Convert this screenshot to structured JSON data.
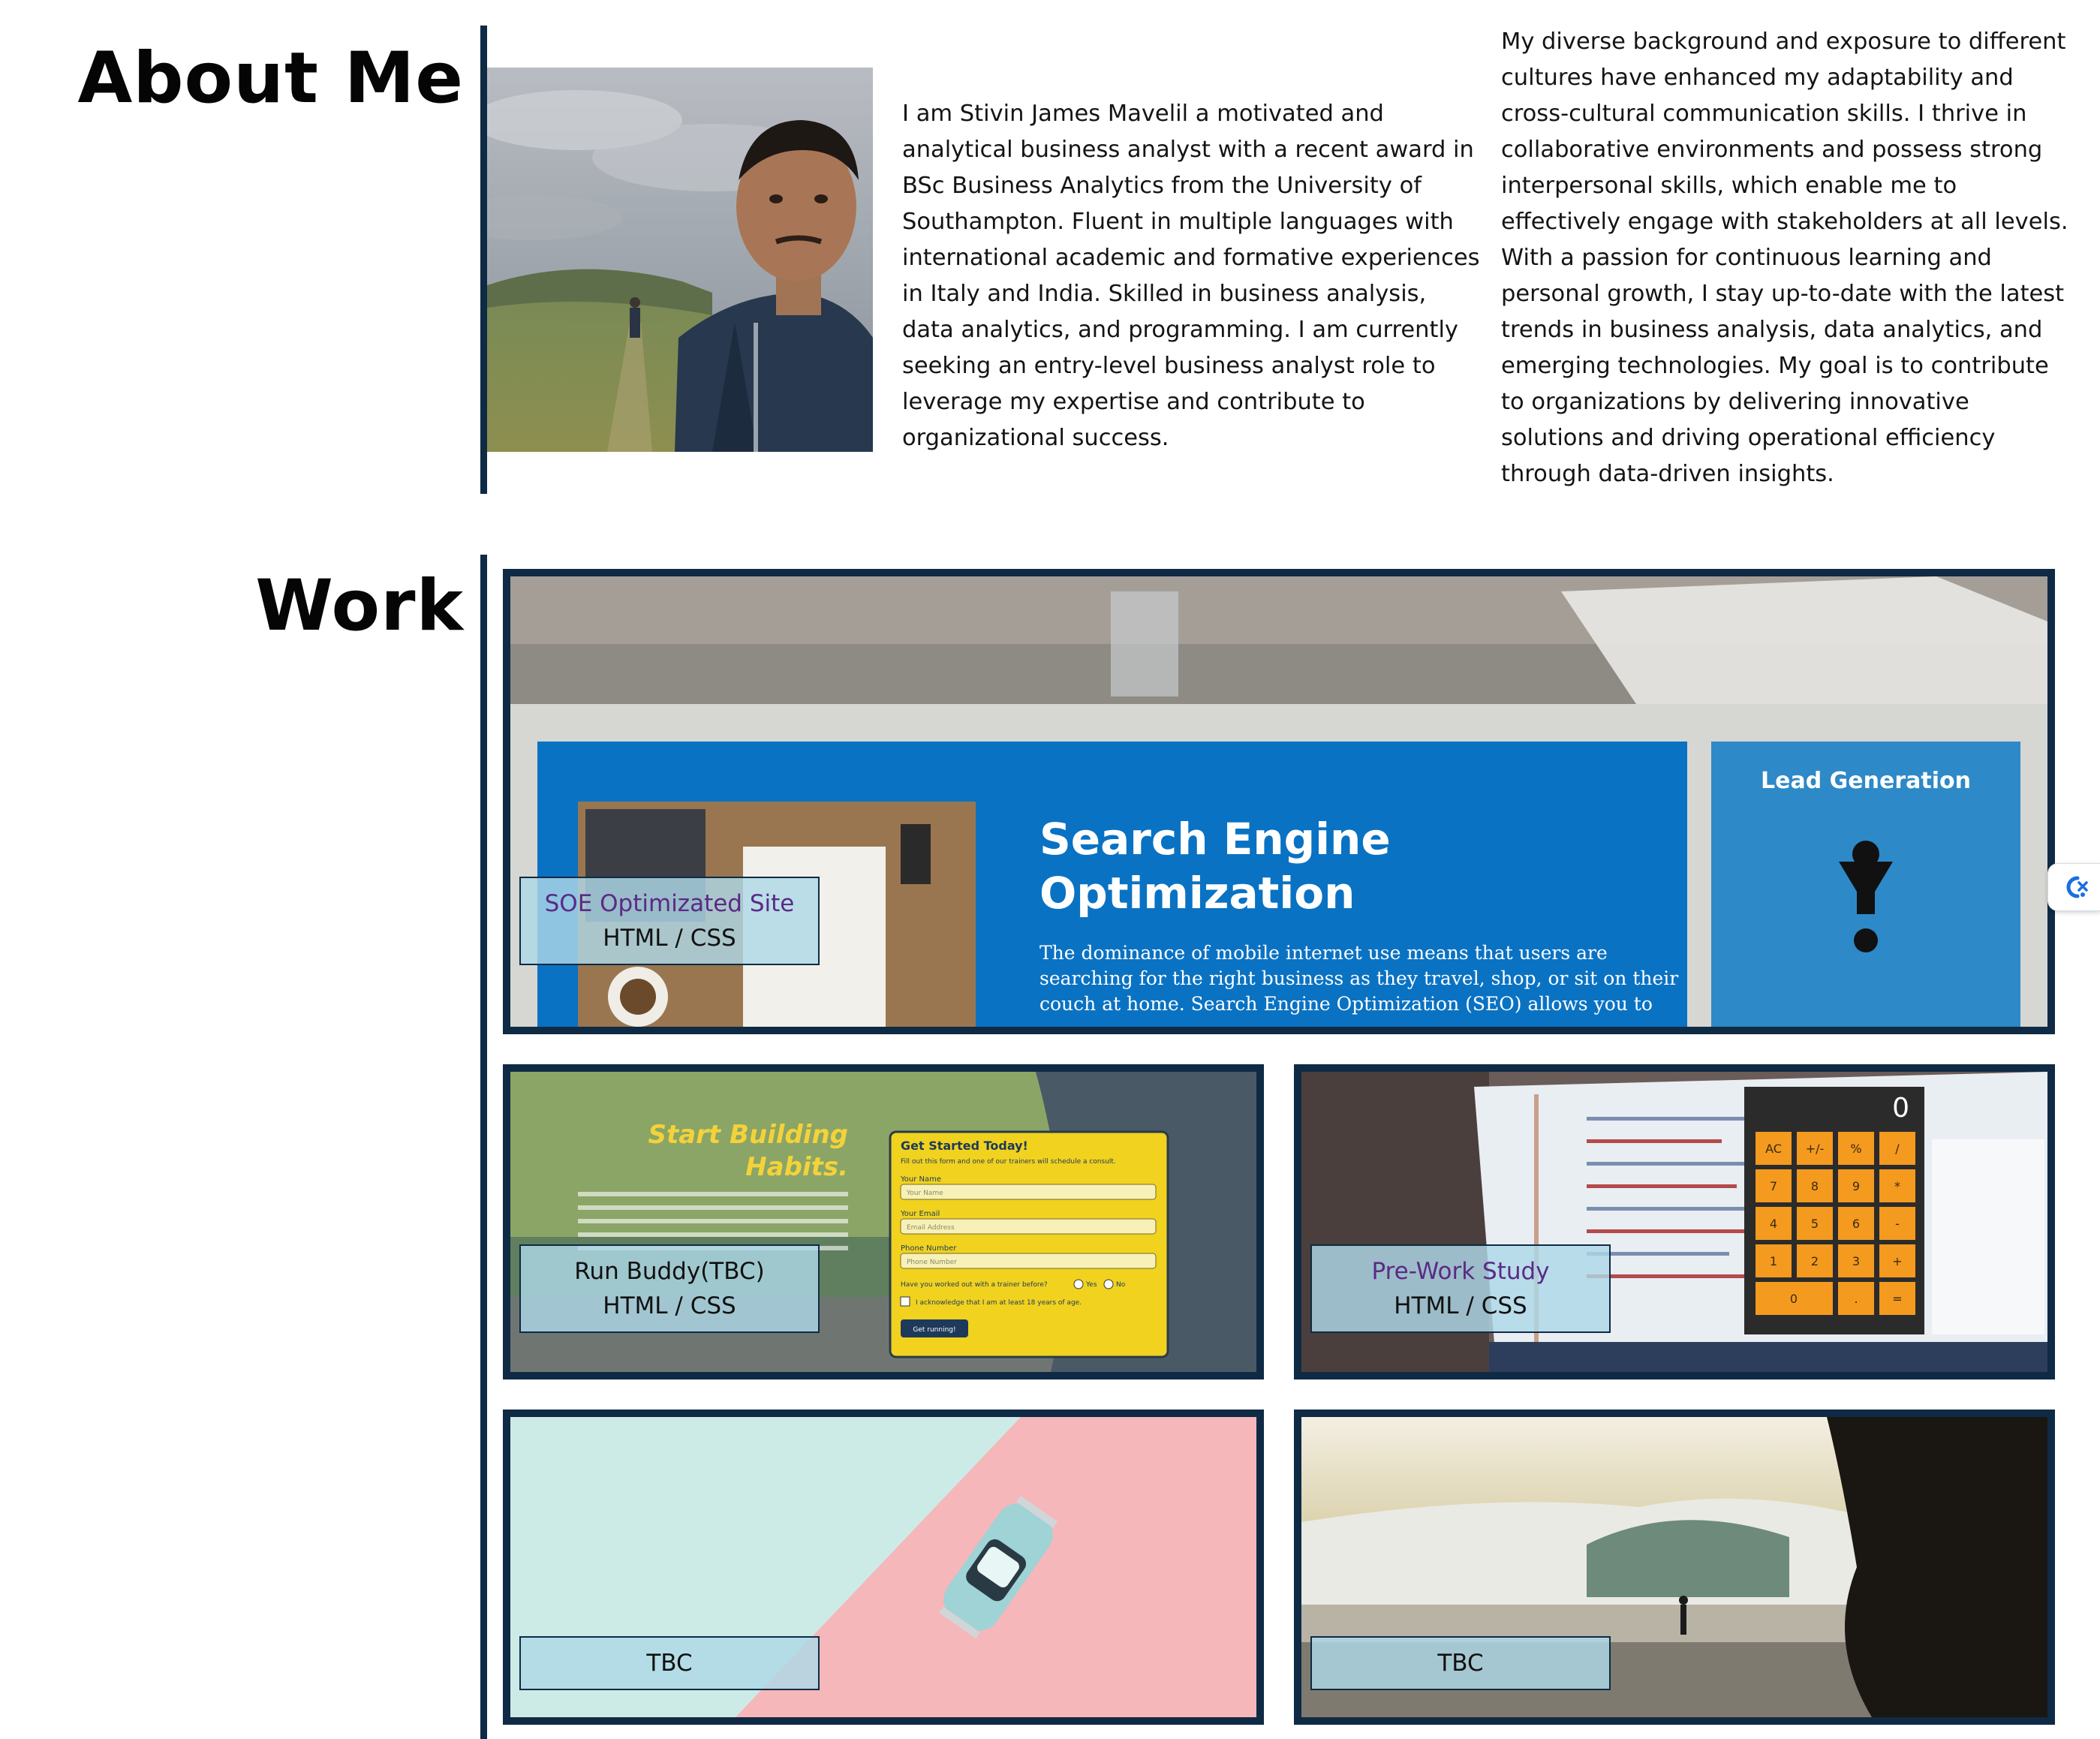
{
  "about": {
    "heading": "About Me",
    "bio_1": "I am Stivin James Mavelil a motivated and analytical business analyst with a recent award in BSc Business Analytics from the University of Southampton. Fluent in multiple languages with international academic and formative experiences in Italy and India. Skilled in business analysis, data analytics, and programming. I am currently seeking an entry-level business analyst role to leverage my expertise and contribute to organizational success.",
    "bio_2": "My diverse background and exposure to different cultures have enhanced my adaptability and cross-cultural communication skills. I thrive in collaborative environments and possess strong interpersonal skills, which enable me to effectively engage with stakeholders at all levels. With a passion for continuous learning and personal growth, I stay up-to-date with the latest trends in business analysis, data analytics, and emerging technologies. My goal is to contribute to organizations by delivering innovative solutions and driving operational efficiency through data-driven insights."
  },
  "work": {
    "heading": "Work",
    "projects": [
      {
        "title": "SOE Optimizated Site",
        "tech": "HTML / CSS",
        "screenshot": {
          "hero_title_1": "Search Engine",
          "hero_title_2": "Optimization",
          "hero_text_1": "The dominance of mobile internet use means that users are",
          "hero_text_2": "searching for the right business as they travel, shop, or sit on their",
          "hero_text_3": "couch at home. Search Engine Optimization (SEO) allows you to",
          "side_title": "Lead Generation"
        }
      },
      {
        "title": "Run Buddy(TBC)",
        "screenshot": {
          "headline_1": "Start Building",
          "headline_2": "Habits.",
          "form_title": "Get Started Today!",
          "form_sub": "Fill out this form and one of our trainers will schedule a consult.",
          "name_label": "Your Name",
          "name_placeholder": "Your Name",
          "email_label": "Your Email",
          "email_placeholder": "Email Address",
          "phone_label": "Phone Number",
          "phone_placeholder": "Phone Number",
          "question": "Have you worked out with a trainer before?",
          "yes": "Yes",
          "no": "No",
          "ack": "I acknowledge that I am at least 18 years of age.",
          "button": "Get running!"
        }
      },
      {
        "title": "Pre-Work Study",
        "tech": "HTML / CSS",
        "screenshot": {
          "calc_display": "0",
          "calc_keys": [
            "AC",
            "+/-",
            "%",
            "/",
            "7",
            "8",
            "9",
            "*",
            "4",
            "5",
            "6",
            "-",
            "1",
            "2",
            "3",
            "+",
            "0",
            ".",
            "="
          ]
        }
      },
      {
        "title": "TBC"
      },
      {
        "title": "TBC"
      }
    ]
  },
  "colors": {
    "frame": "#0f2a44",
    "label_bg": "#add8e6",
    "link": "#5b2a86"
  },
  "icons": {
    "translate": "translate-icon"
  }
}
